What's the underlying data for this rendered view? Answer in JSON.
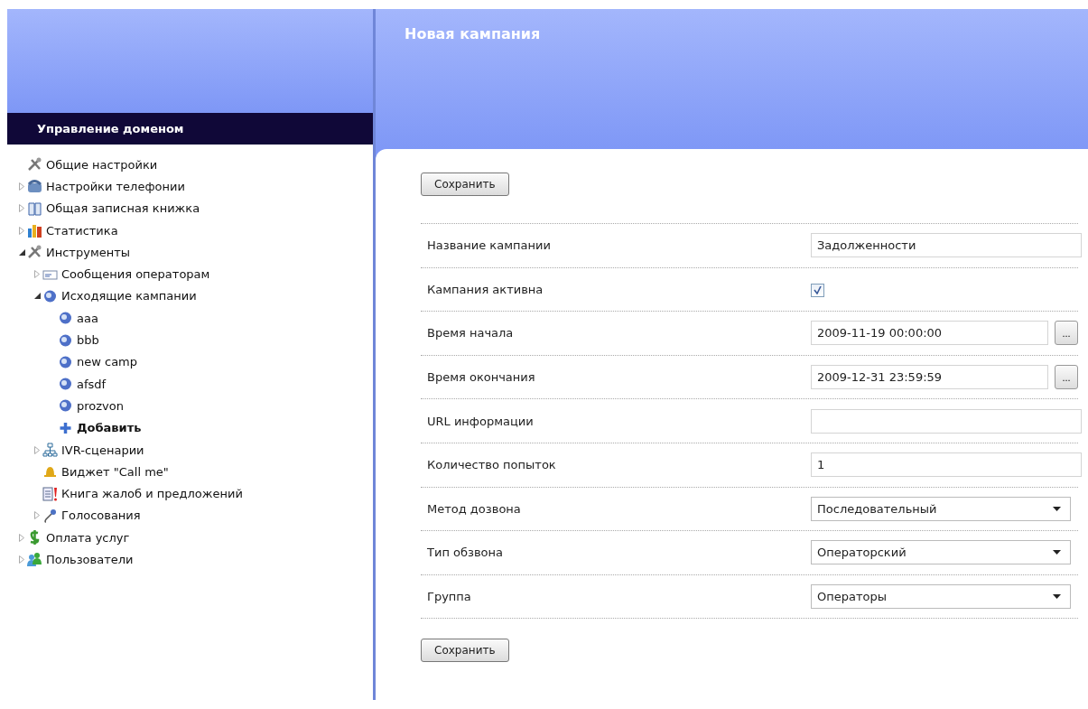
{
  "sidebar": {
    "title": "Управление доменом",
    "tree": [
      {
        "label": "Общие настройки"
      },
      {
        "label": "Настройки телефонии",
        "expanded": false
      },
      {
        "label": "Общая записная книжка",
        "expanded": false
      },
      {
        "label": "Статистика",
        "expanded": false
      },
      {
        "label": "Инструменты",
        "expanded": true,
        "children": [
          {
            "label": "Сообщения операторам",
            "expanded": false
          },
          {
            "label": "Исходящие кампании",
            "expanded": true,
            "children": [
              {
                "label": "aaa",
                "kind": "campaign"
              },
              {
                "label": "bbb",
                "kind": "campaign"
              },
              {
                "label": "new camp",
                "kind": "campaign"
              },
              {
                "label": "afsdf",
                "kind": "campaign"
              },
              {
                "label": "prozvon",
                "kind": "campaign"
              },
              {
                "label": "Добавить",
                "kind": "add"
              }
            ]
          },
          {
            "label": "IVR-сценарии",
            "expanded": false
          },
          {
            "label": "Виджет \"Call me\""
          },
          {
            "label": "Книга жалоб и предложений"
          },
          {
            "label": "Голосования",
            "expanded": false
          }
        ]
      },
      {
        "label": "Оплата услуг",
        "expanded": false
      },
      {
        "label": "Пользователи",
        "expanded": false
      }
    ]
  },
  "main": {
    "title": "Новая кампания",
    "save_button": "Сохранить",
    "fields": [
      {
        "kind": "text",
        "label": "Название кампании",
        "value": "Задолженности"
      },
      {
        "kind": "checkbox",
        "label": "Кампания активна",
        "checked": true
      },
      {
        "kind": "datetime",
        "label": "Время начала",
        "value": "2009-11-19 00:00:00",
        "button": "..."
      },
      {
        "kind": "datetime",
        "label": "Время окончания",
        "value": "2009-12-31 23:59:59",
        "button": "..."
      },
      {
        "kind": "text",
        "label": "URL информации"
      },
      {
        "kind": "text",
        "label": "Количество попыток",
        "value": "1"
      },
      {
        "kind": "select",
        "label": "Метод дозвона",
        "value": "Последовательный"
      },
      {
        "kind": "select",
        "label": "Тип обзвона",
        "value": "Операторский"
      },
      {
        "kind": "select",
        "label": "Группа",
        "value": "Операторы"
      }
    ],
    "save_button_bottom": "Сохранить"
  }
}
